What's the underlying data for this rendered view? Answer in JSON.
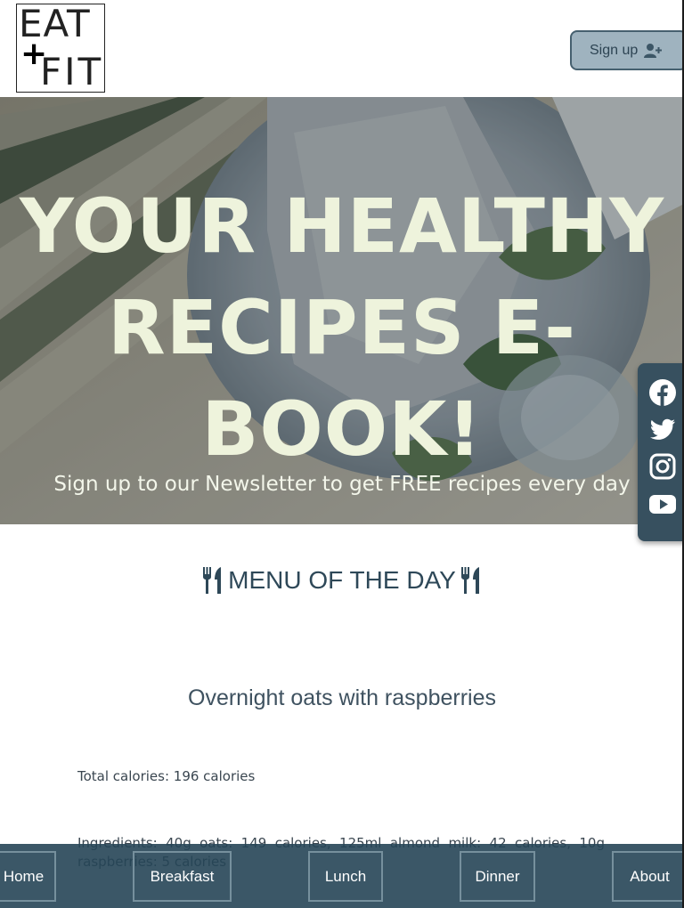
{
  "header": {
    "logo_top": "EAT",
    "logo_plus": "+",
    "logo_bottom": "FIT",
    "signup_label": "Sign up"
  },
  "hero": {
    "title_line1": "YOUR HEALTHY",
    "title_line2": "RECIPES E-BOOK!",
    "subtitle": "Sign up to our Newsletter to get FREE recipes every day"
  },
  "social": {
    "items": [
      {
        "name": "facebook-icon"
      },
      {
        "name": "twitter-icon"
      },
      {
        "name": "instagram-icon"
      },
      {
        "name": "youtube-icon"
      }
    ]
  },
  "menu": {
    "heading": "MENU OF THE DAY",
    "recipe_title": "Overnight oats with raspberries",
    "total_calories": "Total calories: 196 calories",
    "ingredients": "Ingredients: 40g oats: 149 calories, 125ml almond milk: 42 calories, 10g raspberries: 5 calories"
  },
  "nav": {
    "items": [
      {
        "label": "Home"
      },
      {
        "label": "Breakfast"
      },
      {
        "label": "Lunch"
      },
      {
        "label": "Dinner"
      },
      {
        "label": "About"
      }
    ]
  },
  "colors": {
    "brand_dark": "#2e4858",
    "hero_text": "#eef3dc",
    "signup_bg": "#9fb3bf",
    "nav_bg": "#264556"
  }
}
